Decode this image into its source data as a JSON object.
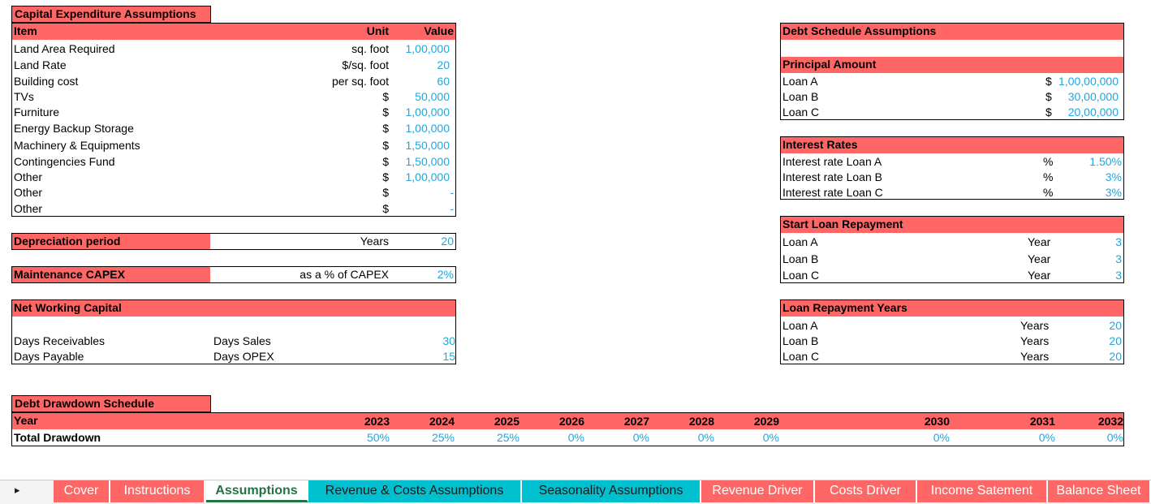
{
  "capex": {
    "title": "Capital Expenditure Assumptions",
    "col_item": "Item",
    "col_unit": "Unit",
    "col_value": "Value",
    "rows": [
      {
        "item": "Land Area Required",
        "unit": "sq. foot",
        "value": "1,00,000"
      },
      {
        "item": "Land Rate",
        "unit": "$/sq. foot",
        "value": "20"
      },
      {
        "item": "Building cost",
        "unit": "per sq. foot",
        "value": "60"
      },
      {
        "item": "TVs",
        "unit": "$",
        "value": "50,000"
      },
      {
        "item": "Furniture",
        "unit": "$",
        "value": "1,00,000"
      },
      {
        "item": "Energy Backup Storage",
        "unit": "$",
        "value": "1,00,000"
      },
      {
        "item": "Machinery & Equipments",
        "unit": "$",
        "value": "1,50,000"
      },
      {
        "item": "Contingencies Fund",
        "unit": "$",
        "value": "1,50,000"
      },
      {
        "item": "Other",
        "unit": "$",
        "value": "1,00,000"
      },
      {
        "item": "Other",
        "unit": "$",
        "value": "-"
      },
      {
        "item": "Other",
        "unit": "$",
        "value": "-"
      }
    ]
  },
  "depreciation": {
    "label": "Depreciation period",
    "unit": "Years",
    "value": "20"
  },
  "maintenance": {
    "label": "Maintenance CAPEX",
    "unit": "as a % of CAPEX",
    "value": "2%"
  },
  "nwc": {
    "title": "Net Working Capital",
    "rows": [
      {
        "label": "Days Receivables",
        "unit": "Days Sales",
        "value": "30"
      },
      {
        "label": "Days Payable",
        "unit": "Days OPEX",
        "value": "15"
      }
    ]
  },
  "debt": {
    "title": "Debt Schedule Assumptions",
    "principal": {
      "title": "Principal Amount",
      "rows": [
        {
          "label": "Loan A",
          "unit": "$",
          "value": "1,00,00,000"
        },
        {
          "label": "Loan B",
          "unit": "$",
          "value": "30,00,000"
        },
        {
          "label": "Loan C",
          "unit": "$",
          "value": "20,00,000"
        }
      ]
    },
    "interest": {
      "title": "Interest Rates",
      "rows": [
        {
          "label": "Interest rate Loan A",
          "unit": "%",
          "value": "1.50%"
        },
        {
          "label": "Interest rate Loan B",
          "unit": "%",
          "value": "3%"
        },
        {
          "label": "Interest rate Loan C",
          "unit": "%",
          "value": "3%"
        }
      ]
    },
    "start": {
      "title": "Start Loan Repayment",
      "rows": [
        {
          "label": "Loan A",
          "unit": "Year",
          "value": "3"
        },
        {
          "label": "Loan B",
          "unit": "Year",
          "value": "3"
        },
        {
          "label": "Loan C",
          "unit": "Year",
          "value": "3"
        }
      ]
    },
    "years": {
      "title": "Loan Repayment Years",
      "rows": [
        {
          "label": "Loan A",
          "unit": "Years",
          "value": "20"
        },
        {
          "label": "Loan B",
          "unit": "Years",
          "value": "20"
        },
        {
          "label": "Loan C",
          "unit": "Years",
          "value": "20"
        }
      ]
    }
  },
  "drawdown": {
    "title": "Debt Drawdown Schedule",
    "year_label": "Year",
    "total_label": "Total Drawdown",
    "years": [
      "2023",
      "2024",
      "2025",
      "2026",
      "2027",
      "2028",
      "2029",
      "2030",
      "2031",
      "2032"
    ],
    "values": [
      "50%",
      "25%",
      "25%",
      "0%",
      "0%",
      "0%",
      "0%",
      "0%",
      "0%",
      "0%"
    ]
  },
  "tabs": {
    "nav_arrow": "▸",
    "items": [
      {
        "label": "Cover",
        "style": "red"
      },
      {
        "label": "Instructions",
        "style": "red"
      },
      {
        "label": "Assumptions",
        "style": "active"
      },
      {
        "label": "Revenue & Costs Assumptions",
        "style": "cyan"
      },
      {
        "label": "Seasonality Assumptions",
        "style": "cyan"
      },
      {
        "label": "Revenue Driver",
        "style": "red"
      },
      {
        "label": "Costs Driver",
        "style": "red"
      },
      {
        "label": "Income Satement",
        "style": "red"
      },
      {
        "label": "Balance Sheet",
        "style": "red"
      }
    ]
  }
}
